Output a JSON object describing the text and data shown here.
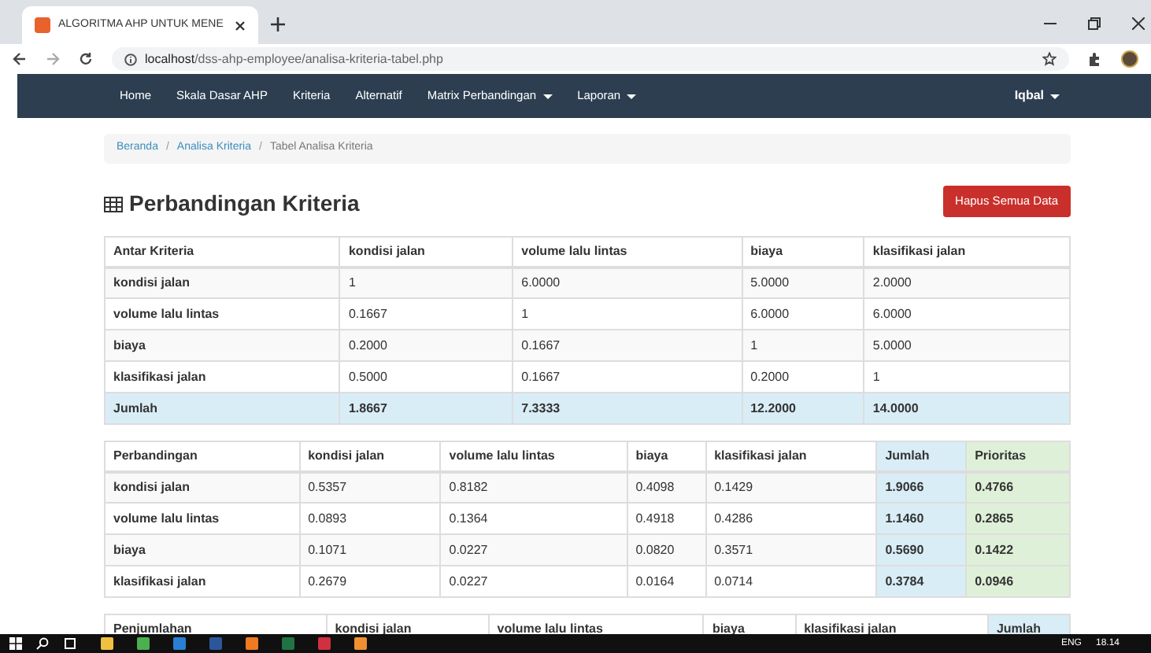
{
  "browser": {
    "tab_title": "ALGORITMA AHP UNTUK MENE",
    "url_host": "localhost",
    "url_path": "/dss-ahp-employee/analisa-kriteria-tabel.php"
  },
  "navbar": {
    "items": [
      {
        "label": "Home",
        "dropdown": false
      },
      {
        "label": "Skala Dasar AHP",
        "dropdown": false
      },
      {
        "label": "Kriteria",
        "dropdown": false
      },
      {
        "label": "Alternatif",
        "dropdown": false
      },
      {
        "label": "Matrix Perbandingan",
        "dropdown": true
      },
      {
        "label": "Laporan",
        "dropdown": true
      }
    ],
    "user": "Iqbal"
  },
  "breadcrumb_separator": "/",
  "breadcrumb": [
    {
      "label": "Beranda",
      "link": true
    },
    {
      "label": "Analisa Kriteria",
      "link": true
    },
    {
      "label": "Tabel Analisa Kriteria",
      "link": false
    }
  ],
  "title": "Perbandingan Kriteria",
  "delete_button": "Hapus Semua Data",
  "table1": {
    "columns": [
      "Antar Kriteria",
      "kondisi jalan",
      "volume lalu lintas",
      "biaya",
      "klasifikasi jalan"
    ],
    "rows": [
      [
        "kondisi jalan",
        "1",
        "6.0000",
        "5.0000",
        "2.0000"
      ],
      [
        "volume lalu lintas",
        "0.1667",
        "1",
        "6.0000",
        "6.0000"
      ],
      [
        "biaya",
        "0.2000",
        "0.1667",
        "1",
        "5.0000"
      ],
      [
        "klasifikasi jalan",
        "0.5000",
        "0.1667",
        "0.2000",
        "1"
      ]
    ],
    "total": [
      "Jumlah",
      "1.8667",
      "7.3333",
      "12.2000",
      "14.0000"
    ]
  },
  "table2": {
    "columns": [
      "Perbandingan",
      "kondisi jalan",
      "volume lalu lintas",
      "biaya",
      "klasifikasi jalan",
      "Jumlah",
      "Prioritas"
    ],
    "rows": [
      [
        "kondisi jalan",
        "0.5357",
        "0.8182",
        "0.4098",
        "0.1429",
        "1.9066",
        "0.4766"
      ],
      [
        "volume lalu lintas",
        "0.0893",
        "0.1364",
        "0.4918",
        "0.4286",
        "1.1460",
        "0.2865"
      ],
      [
        "biaya",
        "0.1071",
        "0.0227",
        "0.0820",
        "0.3571",
        "0.5690",
        "0.1422"
      ],
      [
        "klasifikasi jalan",
        "0.2679",
        "0.0227",
        "0.0164",
        "0.0714",
        "0.3784",
        "0.0946"
      ]
    ]
  },
  "table3": {
    "columns": [
      "Penjumlahan",
      "kondisi jalan",
      "volume lalu lintas",
      "biaya",
      "klasifikasi jalan",
      "Jumlah"
    ]
  },
  "taskbar": {
    "language": "ENG",
    "time": "18.14"
  }
}
